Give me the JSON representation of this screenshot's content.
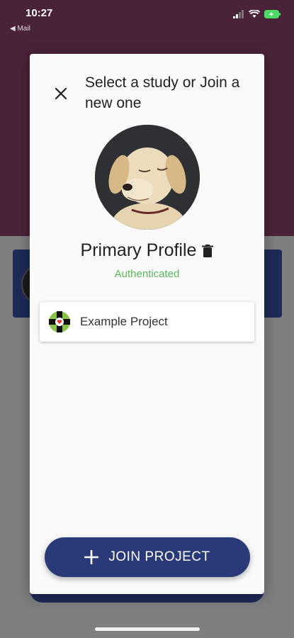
{
  "status_bar": {
    "time": "10:27",
    "back_app": "◀ Mail"
  },
  "dialog": {
    "title": "Select a study or Join a new one",
    "profile_name": "Primary Profile",
    "profile_status": "Authenticated",
    "projects": [
      {
        "label": "Example Project"
      }
    ],
    "join_button_label": "JOIN PROJECT"
  },
  "colors": {
    "header_bg": "#4a2338",
    "accent": "#2a3a78",
    "status_green": "#5cb85c"
  }
}
